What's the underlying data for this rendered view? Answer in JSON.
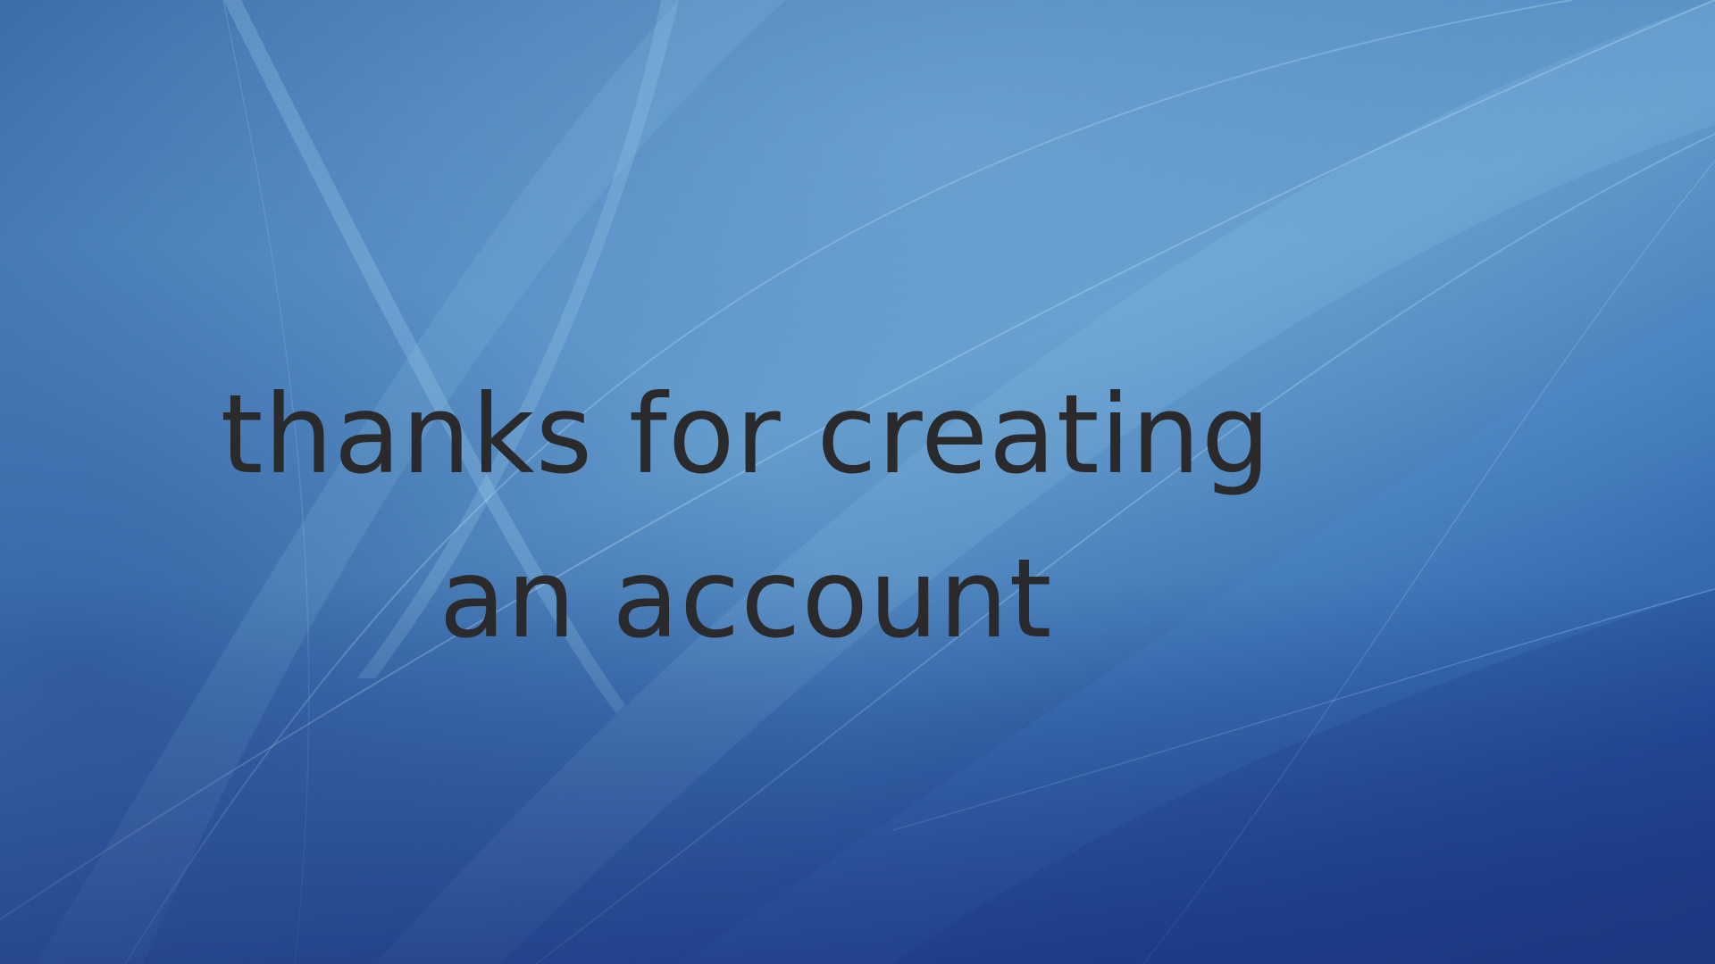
{
  "screen": {
    "message": "thanks for creating an account",
    "background_colors": [
      "#3a6aa8",
      "#5b95c8",
      "#234d98",
      "#1e3a82"
    ],
    "text_color": "#2a2a2c"
  }
}
